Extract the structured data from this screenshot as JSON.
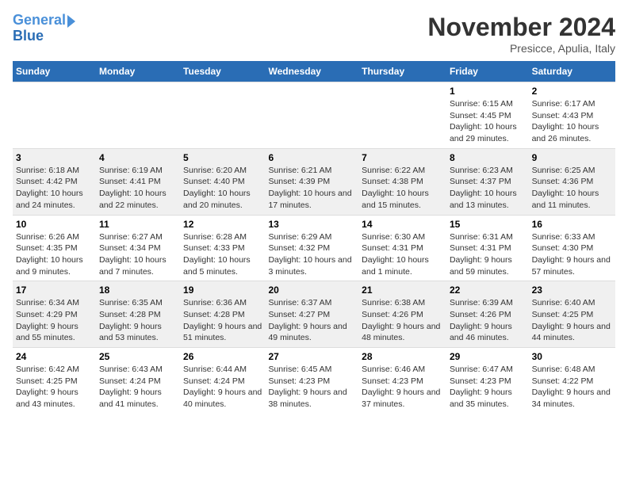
{
  "header": {
    "logo_line1": "General",
    "logo_line2": "Blue",
    "month": "November 2024",
    "location": "Presicce, Apulia, Italy"
  },
  "days_of_week": [
    "Sunday",
    "Monday",
    "Tuesday",
    "Wednesday",
    "Thursday",
    "Friday",
    "Saturday"
  ],
  "weeks": [
    {
      "days": [
        {
          "num": "",
          "sunrise": "",
          "sunset": "",
          "daylight": ""
        },
        {
          "num": "",
          "sunrise": "",
          "sunset": "",
          "daylight": ""
        },
        {
          "num": "",
          "sunrise": "",
          "sunset": "",
          "daylight": ""
        },
        {
          "num": "",
          "sunrise": "",
          "sunset": "",
          "daylight": ""
        },
        {
          "num": "",
          "sunrise": "",
          "sunset": "",
          "daylight": ""
        },
        {
          "num": "1",
          "sunrise": "Sunrise: 6:15 AM",
          "sunset": "Sunset: 4:45 PM",
          "daylight": "Daylight: 10 hours and 29 minutes."
        },
        {
          "num": "2",
          "sunrise": "Sunrise: 6:17 AM",
          "sunset": "Sunset: 4:43 PM",
          "daylight": "Daylight: 10 hours and 26 minutes."
        }
      ]
    },
    {
      "days": [
        {
          "num": "3",
          "sunrise": "Sunrise: 6:18 AM",
          "sunset": "Sunset: 4:42 PM",
          "daylight": "Daylight: 10 hours and 24 minutes."
        },
        {
          "num": "4",
          "sunrise": "Sunrise: 6:19 AM",
          "sunset": "Sunset: 4:41 PM",
          "daylight": "Daylight: 10 hours and 22 minutes."
        },
        {
          "num": "5",
          "sunrise": "Sunrise: 6:20 AM",
          "sunset": "Sunset: 4:40 PM",
          "daylight": "Daylight: 10 hours and 20 minutes."
        },
        {
          "num": "6",
          "sunrise": "Sunrise: 6:21 AM",
          "sunset": "Sunset: 4:39 PM",
          "daylight": "Daylight: 10 hours and 17 minutes."
        },
        {
          "num": "7",
          "sunrise": "Sunrise: 6:22 AM",
          "sunset": "Sunset: 4:38 PM",
          "daylight": "Daylight: 10 hours and 15 minutes."
        },
        {
          "num": "8",
          "sunrise": "Sunrise: 6:23 AM",
          "sunset": "Sunset: 4:37 PM",
          "daylight": "Daylight: 10 hours and 13 minutes."
        },
        {
          "num": "9",
          "sunrise": "Sunrise: 6:25 AM",
          "sunset": "Sunset: 4:36 PM",
          "daylight": "Daylight: 10 hours and 11 minutes."
        }
      ]
    },
    {
      "days": [
        {
          "num": "10",
          "sunrise": "Sunrise: 6:26 AM",
          "sunset": "Sunset: 4:35 PM",
          "daylight": "Daylight: 10 hours and 9 minutes."
        },
        {
          "num": "11",
          "sunrise": "Sunrise: 6:27 AM",
          "sunset": "Sunset: 4:34 PM",
          "daylight": "Daylight: 10 hours and 7 minutes."
        },
        {
          "num": "12",
          "sunrise": "Sunrise: 6:28 AM",
          "sunset": "Sunset: 4:33 PM",
          "daylight": "Daylight: 10 hours and 5 minutes."
        },
        {
          "num": "13",
          "sunrise": "Sunrise: 6:29 AM",
          "sunset": "Sunset: 4:32 PM",
          "daylight": "Daylight: 10 hours and 3 minutes."
        },
        {
          "num": "14",
          "sunrise": "Sunrise: 6:30 AM",
          "sunset": "Sunset: 4:31 PM",
          "daylight": "Daylight: 10 hours and 1 minute."
        },
        {
          "num": "15",
          "sunrise": "Sunrise: 6:31 AM",
          "sunset": "Sunset: 4:31 PM",
          "daylight": "Daylight: 9 hours and 59 minutes."
        },
        {
          "num": "16",
          "sunrise": "Sunrise: 6:33 AM",
          "sunset": "Sunset: 4:30 PM",
          "daylight": "Daylight: 9 hours and 57 minutes."
        }
      ]
    },
    {
      "days": [
        {
          "num": "17",
          "sunrise": "Sunrise: 6:34 AM",
          "sunset": "Sunset: 4:29 PM",
          "daylight": "Daylight: 9 hours and 55 minutes."
        },
        {
          "num": "18",
          "sunrise": "Sunrise: 6:35 AM",
          "sunset": "Sunset: 4:28 PM",
          "daylight": "Daylight: 9 hours and 53 minutes."
        },
        {
          "num": "19",
          "sunrise": "Sunrise: 6:36 AM",
          "sunset": "Sunset: 4:28 PM",
          "daylight": "Daylight: 9 hours and 51 minutes."
        },
        {
          "num": "20",
          "sunrise": "Sunrise: 6:37 AM",
          "sunset": "Sunset: 4:27 PM",
          "daylight": "Daylight: 9 hours and 49 minutes."
        },
        {
          "num": "21",
          "sunrise": "Sunrise: 6:38 AM",
          "sunset": "Sunset: 4:26 PM",
          "daylight": "Daylight: 9 hours and 48 minutes."
        },
        {
          "num": "22",
          "sunrise": "Sunrise: 6:39 AM",
          "sunset": "Sunset: 4:26 PM",
          "daylight": "Daylight: 9 hours and 46 minutes."
        },
        {
          "num": "23",
          "sunrise": "Sunrise: 6:40 AM",
          "sunset": "Sunset: 4:25 PM",
          "daylight": "Daylight: 9 hours and 44 minutes."
        }
      ]
    },
    {
      "days": [
        {
          "num": "24",
          "sunrise": "Sunrise: 6:42 AM",
          "sunset": "Sunset: 4:25 PM",
          "daylight": "Daylight: 9 hours and 43 minutes."
        },
        {
          "num": "25",
          "sunrise": "Sunrise: 6:43 AM",
          "sunset": "Sunset: 4:24 PM",
          "daylight": "Daylight: 9 hours and 41 minutes."
        },
        {
          "num": "26",
          "sunrise": "Sunrise: 6:44 AM",
          "sunset": "Sunset: 4:24 PM",
          "daylight": "Daylight: 9 hours and 40 minutes."
        },
        {
          "num": "27",
          "sunrise": "Sunrise: 6:45 AM",
          "sunset": "Sunset: 4:23 PM",
          "daylight": "Daylight: 9 hours and 38 minutes."
        },
        {
          "num": "28",
          "sunrise": "Sunrise: 6:46 AM",
          "sunset": "Sunset: 4:23 PM",
          "daylight": "Daylight: 9 hours and 37 minutes."
        },
        {
          "num": "29",
          "sunrise": "Sunrise: 6:47 AM",
          "sunset": "Sunset: 4:23 PM",
          "daylight": "Daylight: 9 hours and 35 minutes."
        },
        {
          "num": "30",
          "sunrise": "Sunrise: 6:48 AM",
          "sunset": "Sunset: 4:22 PM",
          "daylight": "Daylight: 9 hours and 34 minutes."
        }
      ]
    }
  ]
}
